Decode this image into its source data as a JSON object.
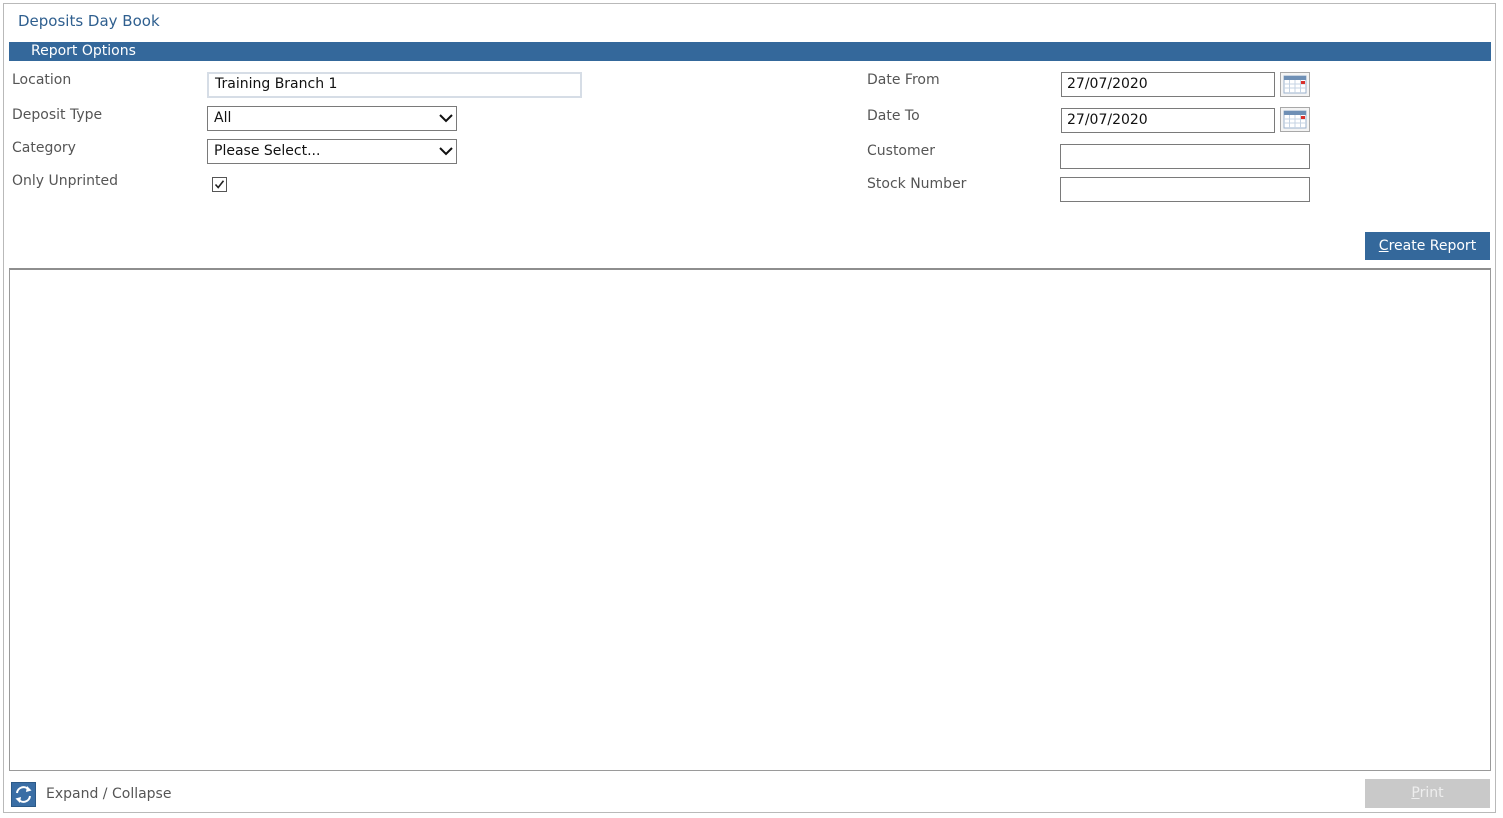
{
  "page": {
    "title": "Deposits Day Book"
  },
  "section": {
    "title": "Report Options"
  },
  "form": {
    "location": {
      "label": "Location",
      "value": "Training Branch 1"
    },
    "deposit_type": {
      "label": "Deposit Type",
      "value": "All"
    },
    "category": {
      "label": "Category",
      "value": "Please Select..."
    },
    "only_unprinted": {
      "label": "Only Unprinted",
      "checked": true
    },
    "date_from": {
      "label": "Date From",
      "value": "27/07/2020"
    },
    "date_to": {
      "label": "Date To",
      "value": "27/07/2020"
    },
    "customer": {
      "label": "Customer",
      "value": ""
    },
    "stock_number": {
      "label": "Stock Number",
      "value": ""
    }
  },
  "actions": {
    "create_report": {
      "label_first": "C",
      "label_rest": "reate Report"
    },
    "print": {
      "label_first": "P",
      "label_rest": "rint",
      "enabled": false
    },
    "expand_collapse": {
      "label": "Expand / Collapse"
    }
  },
  "colors": {
    "accent": "#34689b",
    "title_text": "#2f5f8f",
    "disabled_button": "#c9c9c9"
  },
  "icons": {
    "calendar": "calendar-icon",
    "refresh": "refresh-icon",
    "dropdown": "chevron-down-icon",
    "check": "check-icon"
  }
}
